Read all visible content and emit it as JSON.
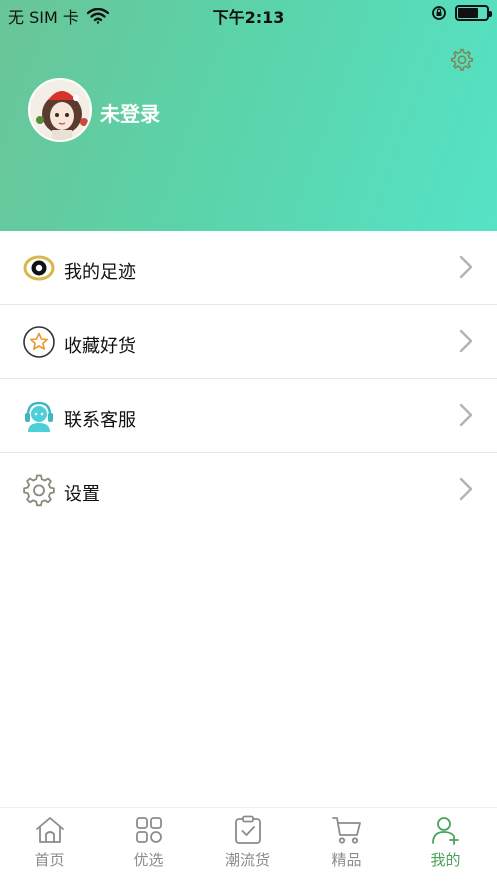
{
  "status_bar": {
    "carrier": "无 SIM 卡",
    "time": "下午2:13"
  },
  "profile": {
    "username": "未登录"
  },
  "menu": {
    "items": [
      {
        "label": "我的足迹",
        "icon": "eye-icon"
      },
      {
        "label": "收藏好货",
        "icon": "star-icon"
      },
      {
        "label": "联系客服",
        "icon": "customer-service-icon"
      },
      {
        "label": "设置",
        "icon": "gear-icon"
      }
    ]
  },
  "tabs": [
    {
      "label": "首页",
      "icon": "home-icon"
    },
    {
      "label": "优选",
      "icon": "grid-icon"
    },
    {
      "label": "潮流货",
      "icon": "clipboard-check-icon"
    },
    {
      "label": "精品",
      "icon": "cart-icon"
    },
    {
      "label": "我的",
      "icon": "user-add-icon",
      "active": true
    }
  ],
  "colors": {
    "header_start": "#69c597",
    "header_end": "#55e3c6",
    "active_tab": "#4aa35a",
    "inactive_tab": "#8c8c8c"
  }
}
